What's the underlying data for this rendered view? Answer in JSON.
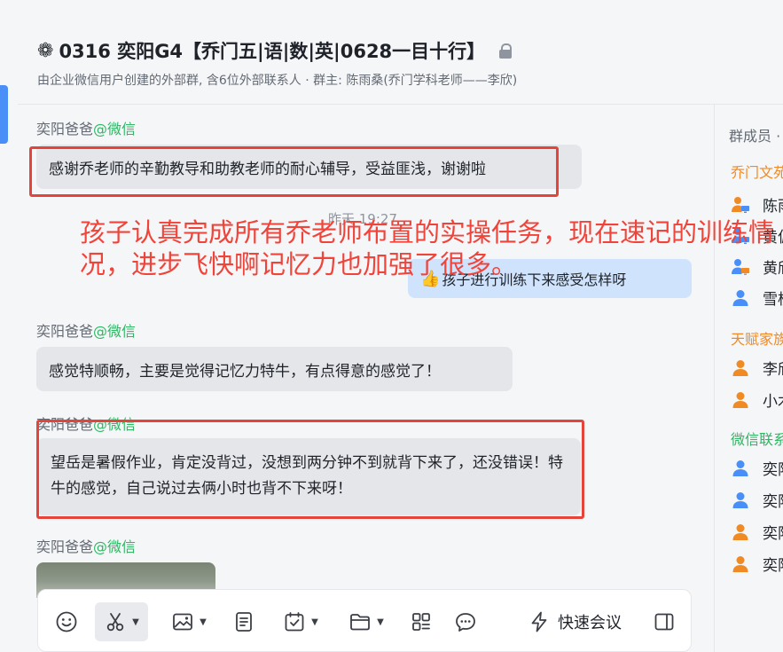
{
  "header": {
    "title": "0316 奕阳G4【乔门五|语|数|英|0628一目十行】",
    "subtitle": "由企业微信用户创建的外部群, 含6位外部联系人 · 群主: 陈雨桑(乔门学科老师——李欣)"
  },
  "messages": [
    {
      "sender": "奕阳爸爸",
      "source": "@微信",
      "text": "感谢乔老师的辛勤教导和助教老师的耐心辅导，受益匪浅，谢谢啦"
    },
    {
      "time": "昨天 19:27"
    },
    {
      "quote_emoji": "👍",
      "quote_text": "孩子进行训练下来感受怎样呀"
    },
    {
      "sender": "奕阳爸爸",
      "source": "@微信",
      "text": "感觉特顺畅，主要是觉得记忆力特牛，有点得意的感觉了！"
    },
    {
      "sender": "奕阳爸爸",
      "source": "@微信",
      "text": "望岳是暑假作业，肯定没背过，没想到两分钟不到就背下来了，还没错误！特牛的感觉，自己说过去俩小时也背不下来呀！"
    },
    {
      "sender": "奕阳爸爸",
      "source": "@微信"
    }
  ],
  "overlay_text": "孩子认真完成所有乔老师布置的实操任务，现在速记的训练情况，进步飞快啊记忆力也加强了很多。",
  "toolbar": {
    "quick_meeting": "快速会议"
  },
  "members": {
    "heading": "群成员 ·",
    "groups": [
      {
        "name": "乔门文苑",
        "color": "#f08a24"
      },
      {
        "name": "天赋家族",
        "color": "#f08a24"
      },
      {
        "name": "微信联系",
        "color": "#2fb764"
      }
    ],
    "items": [
      {
        "name": "陈雨",
        "icon": "person-pc-icon",
        "color": "#f08a24"
      },
      {
        "name": "黄偏",
        "icon": "person-pc-icon",
        "color": "#4a8ff7"
      },
      {
        "name": "黄欣",
        "icon": "person-pc-icon",
        "color": "#4a8ff7"
      },
      {
        "name": "雪枝",
        "icon": "person-icon",
        "color": "#4a8ff7"
      },
      {
        "name": "李欣",
        "icon": "person-icon",
        "color": "#f08a24"
      },
      {
        "name": "小木",
        "icon": "person-icon",
        "color": "#f08a24"
      },
      {
        "name": "奕阳",
        "icon": "person-icon",
        "color": "#4a8ff7"
      },
      {
        "name": "奕阳",
        "icon": "person-icon",
        "color": "#4a8ff7"
      },
      {
        "name": "奕阳",
        "icon": "person-icon",
        "color": "#f08a24"
      },
      {
        "name": "奕阳",
        "icon": "person-icon",
        "color": "#f08a24"
      }
    ]
  },
  "colors": {
    "accent": "#4a8ff7",
    "annotation_red": "#e5443b",
    "wechat_green": "#2fb764",
    "quote_bg": "#cfe3fd",
    "bubble_bg": "#e4e6ea"
  }
}
